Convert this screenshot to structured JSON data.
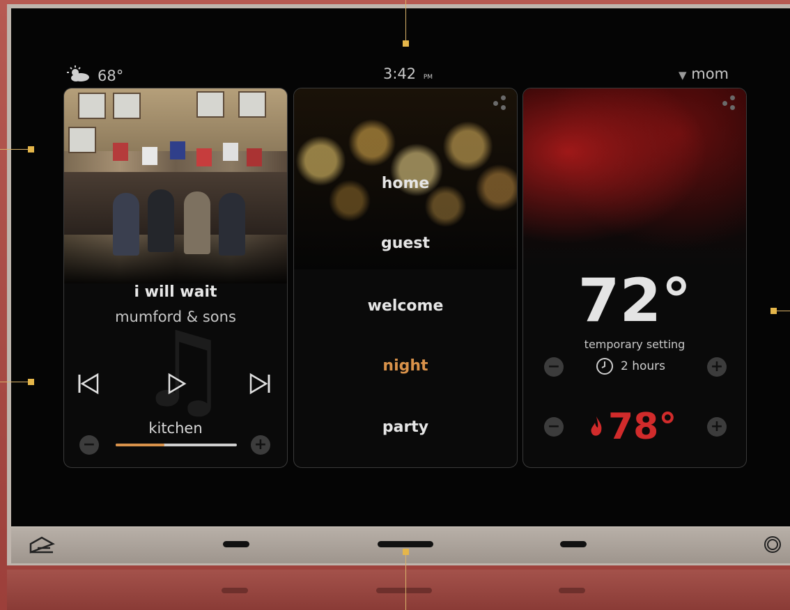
{
  "status": {
    "weather_icon": "partly-cloudy-icon",
    "temperature": "68°",
    "time": "3:42",
    "ampm": "PM",
    "user_caret": "▼",
    "user": "mom"
  },
  "music": {
    "song": "i will wait",
    "artist": "mumford & sons",
    "zone": "kitchen",
    "volume_fraction": 0.4,
    "minus": "−",
    "plus": "+"
  },
  "scenes": {
    "items": [
      "home",
      "guest",
      "welcome",
      "night",
      "party"
    ],
    "active_index": 3,
    "active_color": "#d9924a"
  },
  "climate": {
    "current_temp": "72°",
    "mode_label": "temporary setting",
    "duration": "2 hours",
    "heat_setpoint": "78°",
    "minus": "−",
    "plus": "+",
    "heat_color": "#d12b2b"
  },
  "navbar": {
    "home_icon": "home-icon",
    "power_icon": "circle-button-icon"
  }
}
